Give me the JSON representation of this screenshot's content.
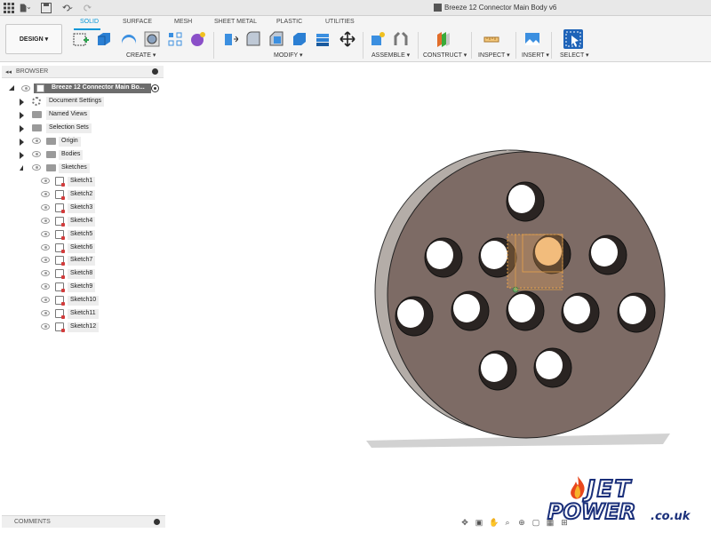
{
  "app": {
    "document_title": "Breeze 12 Connector Main Body v6"
  },
  "ribbon": {
    "design_label": "DESIGN",
    "tabs": [
      {
        "label": "SOLID",
        "active": true
      },
      {
        "label": "SURFACE",
        "active": false
      },
      {
        "label": "MESH",
        "active": false
      },
      {
        "label": "SHEET METAL",
        "active": false
      },
      {
        "label": "PLASTIC",
        "active": false
      },
      {
        "label": "UTILITIES",
        "active": false
      }
    ],
    "groups": [
      {
        "label": "CREATE ▾"
      },
      {
        "label": "MODIFY ▾"
      },
      {
        "label": "ASSEMBLE ▾"
      },
      {
        "label": "CONSTRUCT ▾"
      },
      {
        "label": "INSPECT ▾"
      },
      {
        "label": "INSERT ▾"
      },
      {
        "label": "SELECT ▾"
      }
    ],
    "accent_color": "#0696d7"
  },
  "browser": {
    "header": "BROWSER",
    "root": "Breeze 12 Connector Main Bo...",
    "items": [
      {
        "label": "Document Settings",
        "icon": "gear-icon"
      },
      {
        "label": "Named Views",
        "icon": "folder-icon"
      },
      {
        "label": "Selection Sets",
        "icon": "folder-icon"
      },
      {
        "label": "Origin",
        "icon": "folder-icon"
      },
      {
        "label": "Bodies",
        "icon": "folder-icon"
      },
      {
        "label": "Sketches",
        "icon": "folder-icon"
      }
    ],
    "sketches": [
      "Sketch1",
      "Sketch2",
      "Sketch3",
      "Sketch4",
      "Sketch5",
      "Sketch6",
      "Sketch7",
      "Sketch8",
      "Sketch9",
      "Sketch10",
      "Sketch11",
      "Sketch12"
    ]
  },
  "comments": {
    "label": "COMMENTS"
  },
  "logo": {
    "line1": "JET",
    "line2": "POWER",
    "suffix": ".co.uk"
  },
  "model": {
    "body_color": "#7d6b65",
    "rim_color": "#b4ada8",
    "highlight_color": "#f2c48a",
    "hole_count": 12
  }
}
